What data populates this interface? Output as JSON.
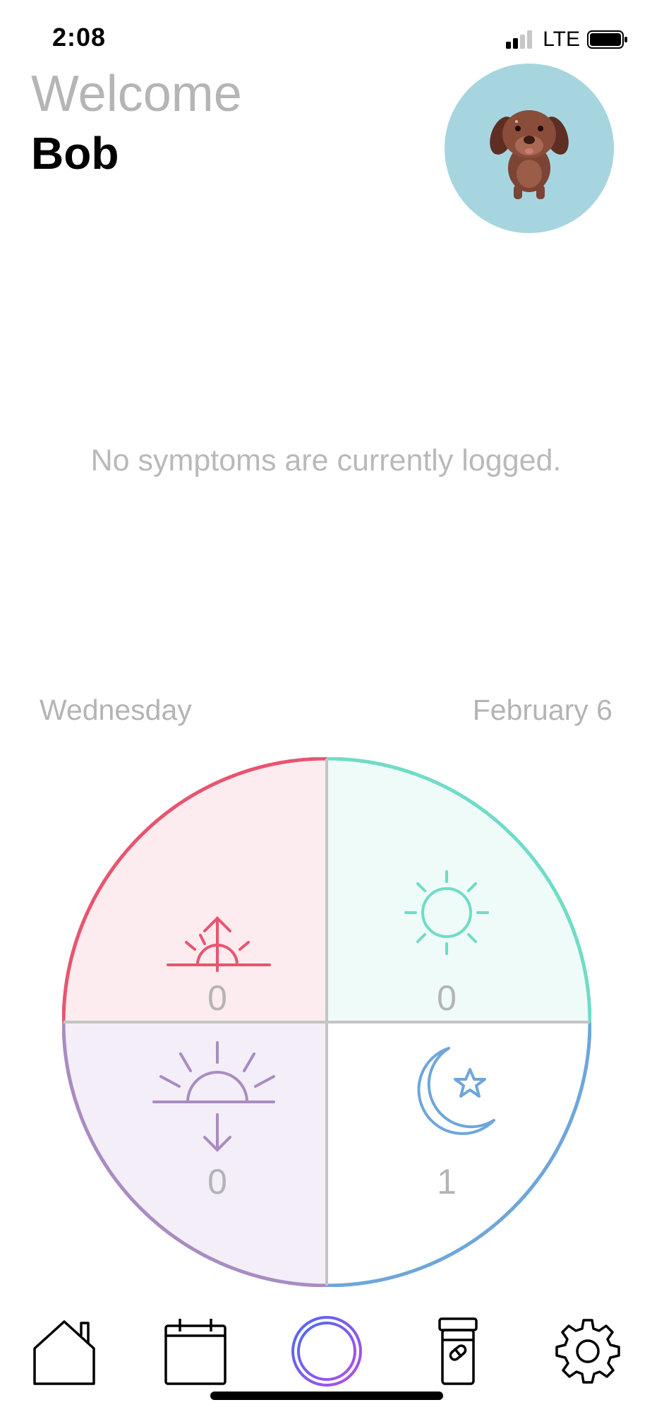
{
  "status": {
    "time": "2:08",
    "network": "LTE"
  },
  "header": {
    "welcome": "Welcome",
    "name": "Bob"
  },
  "main": {
    "empty_message": "No symptoms are currently logged."
  },
  "day": {
    "weekday": "Wednesday",
    "date": "February 6"
  },
  "wheel": {
    "quadrants": [
      {
        "period": "morning",
        "icon": "sunrise-icon",
        "count": "0",
        "color": "#e8546f",
        "fill": "#fcebef"
      },
      {
        "period": "afternoon",
        "icon": "sun-icon",
        "count": "0",
        "color": "#6fdcc6",
        "fill": "#eefbf8"
      },
      {
        "period": "evening",
        "icon": "sunset-icon",
        "count": "0",
        "color": "#a98cc2",
        "fill": "#f3eef7"
      },
      {
        "period": "night",
        "icon": "moon-star-icon",
        "count": "1",
        "color": "#6ea6db",
        "fill": "#ffffff"
      }
    ]
  },
  "tabs": [
    {
      "name": "home",
      "icon": "home-icon"
    },
    {
      "name": "calendar",
      "icon": "calendar-icon"
    },
    {
      "name": "add",
      "icon": "add-icon",
      "colors": [
        "#4a6cf0",
        "#b24de8"
      ]
    },
    {
      "name": "medication",
      "icon": "pill-bottle-icon"
    },
    {
      "name": "settings",
      "icon": "gear-icon"
    }
  ]
}
